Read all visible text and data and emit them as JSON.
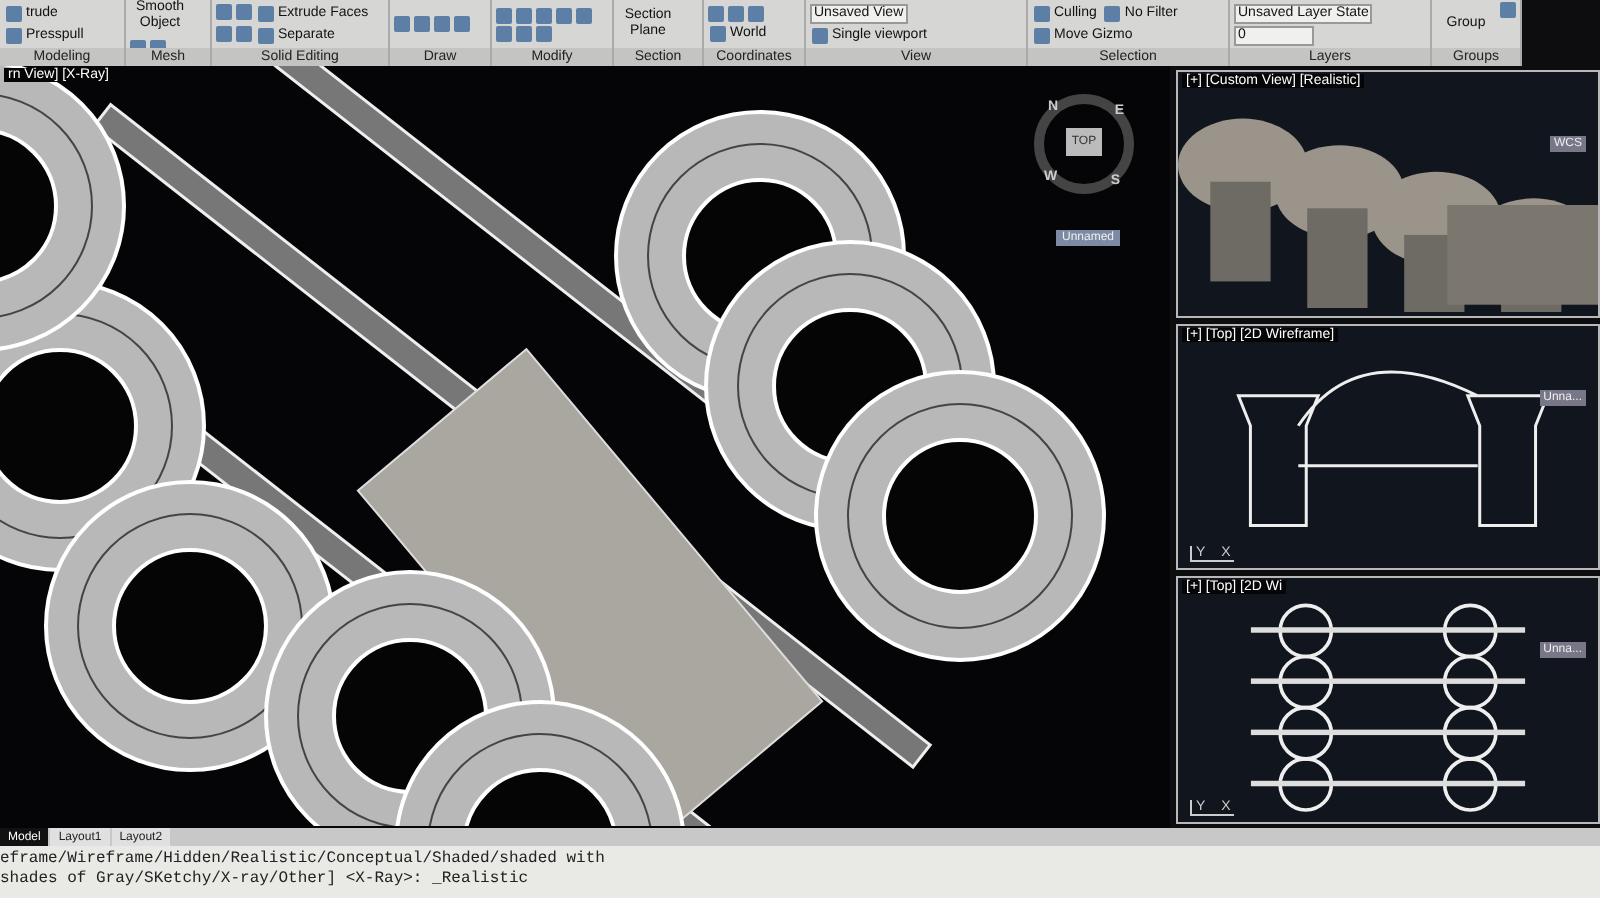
{
  "ribbon": {
    "panels": [
      {
        "title": "Modeling",
        "items": [
          {
            "kind": "button",
            "label": "trude"
          },
          {
            "kind": "button",
            "label": "Presspull"
          }
        ]
      },
      {
        "title": "Mesh",
        "items": [
          {
            "kind": "large",
            "label": "Smooth Object"
          },
          {
            "kind": "icon"
          },
          {
            "kind": "icon"
          }
        ]
      },
      {
        "title": "Solid Editing",
        "items": [
          {
            "kind": "icon"
          },
          {
            "kind": "icon"
          },
          {
            "kind": "button",
            "label": "Extrude Faces"
          },
          {
            "kind": "icon"
          },
          {
            "kind": "icon"
          },
          {
            "kind": "button",
            "label": "Separate"
          }
        ]
      },
      {
        "title": "Draw",
        "items": [
          {
            "kind": "icon"
          },
          {
            "kind": "icon"
          },
          {
            "kind": "icon"
          },
          {
            "kind": "icon"
          }
        ]
      },
      {
        "title": "Modify",
        "items": [
          {
            "kind": "icon"
          },
          {
            "kind": "icon"
          },
          {
            "kind": "icon"
          },
          {
            "kind": "icon"
          },
          {
            "kind": "icon"
          },
          {
            "kind": "icon"
          },
          {
            "kind": "icon"
          },
          {
            "kind": "icon"
          }
        ]
      },
      {
        "title": "Section",
        "items": [
          {
            "kind": "large",
            "label": "Section Plane"
          }
        ]
      },
      {
        "title": "Coordinates",
        "items": [
          {
            "kind": "icon"
          },
          {
            "kind": "icon"
          },
          {
            "kind": "icon"
          },
          {
            "kind": "button",
            "label": "World"
          }
        ]
      },
      {
        "title": "View",
        "items": [
          {
            "kind": "dropdown",
            "label": "Unsaved View"
          },
          {
            "kind": "button",
            "label": "Single viewport"
          }
        ]
      },
      {
        "title": "Selection",
        "items": [
          {
            "kind": "button",
            "label": "Culling"
          },
          {
            "kind": "button",
            "label": "No Filter"
          },
          {
            "kind": "button",
            "label": "Move Gizmo"
          }
        ]
      },
      {
        "title": "Layers",
        "items": [
          {
            "kind": "dropdown",
            "label": "Unsaved Layer State"
          },
          {
            "kind": "dropdown",
            "label": "0"
          }
        ]
      },
      {
        "title": "Groups",
        "items": [
          {
            "kind": "large",
            "label": "Group"
          },
          {
            "kind": "icon"
          }
        ]
      }
    ]
  },
  "main_viewport": {
    "label": "rn View] [X-Ray]",
    "viewcube": {
      "face": "TOP",
      "directions": [
        "N",
        "E",
        "W",
        "S"
      ]
    },
    "named_view": "Unnamed"
  },
  "side_viewports": [
    {
      "kind": "realistic",
      "label": "[+] [Custom View] [Realistic]",
      "badge": "WCS"
    },
    {
      "kind": "profile",
      "label": "[+] [Top] [2D Wireframe]",
      "badge": "Unna...",
      "axes": [
        "Y",
        "X"
      ]
    },
    {
      "kind": "plan",
      "label": "[+] [Top] [2D Wi",
      "badge": "Unna...",
      "axes": [
        "Y",
        "X"
      ]
    }
  ],
  "layout_tabs": [
    {
      "label": "Model",
      "selected": true
    },
    {
      "label": "Layout1",
      "selected": false
    },
    {
      "label": "Layout2",
      "selected": false
    }
  ],
  "command_lines": [
    "eframe/Wireframe/Hidden/Realistic/Conceptual/Shaded/shaded with",
    "shades of Gray/SKetchy/X-ray/Other] <X-Ray>: _Realistic"
  ]
}
